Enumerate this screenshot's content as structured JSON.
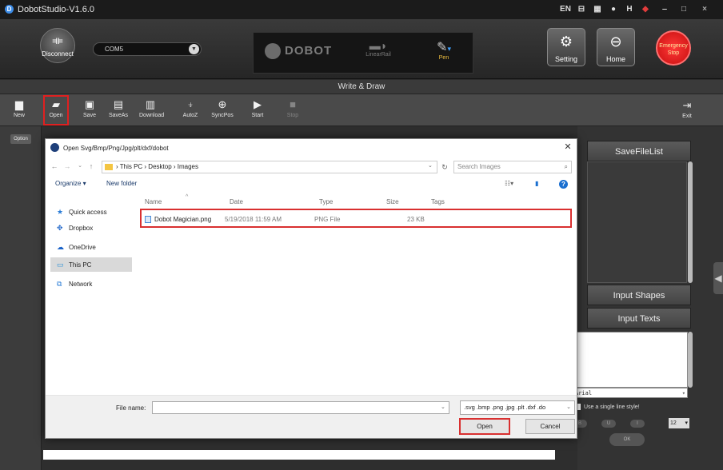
{
  "window": {
    "title": "DobotStudio-V1.6.0",
    "logo_glyph": "D",
    "title_icons": [
      "EN",
      "⊟",
      "▦",
      "●",
      "H",
      "◆",
      "‒",
      "□",
      "×"
    ]
  },
  "header": {
    "disconnect_label": "Disconnect",
    "port_value": "COM5",
    "brand": "DOBOT",
    "linear_rail_label": "LinearRail",
    "tool_label": "Pen",
    "setting_label": "Setting",
    "home_label": "Home",
    "estop_label": "Emergency Stop"
  },
  "mode_title": "Write & Draw",
  "toolbar": {
    "items": [
      {
        "label": "New",
        "icon": "new-file-icon"
      },
      {
        "label": "Open",
        "icon": "open-folder-icon"
      },
      {
        "label": "Save",
        "icon": "save-icon"
      },
      {
        "label": "SaveAs",
        "icon": "save-as-icon"
      },
      {
        "label": "Download",
        "icon": "download-icon"
      },
      {
        "label": "AutoZ",
        "icon": "autoz-icon"
      },
      {
        "label": "SyncPos",
        "icon": "syncpos-icon"
      },
      {
        "label": "Start",
        "icon": "play-icon"
      },
      {
        "label": "Stop",
        "icon": "stop-icon"
      }
    ],
    "exit_label": "Exit"
  },
  "left_panel": {
    "option_label": "Option"
  },
  "right_panel": {
    "save_file_list": "SaveFileList",
    "input_shapes": "Input Shapes",
    "input_texts": "Input Texts",
    "font_value": "Arial",
    "single_line_label": "Use a single line style!",
    "format_buttons": [
      "B",
      "U",
      "I"
    ],
    "size_value": "12",
    "ok_label": "OK"
  },
  "dialog": {
    "title": "Open Svg/Bmp/Png/Jpg/plt/dxf/dobot",
    "address": "› This PC › Desktop › Images",
    "search_placeholder": "Search Images",
    "organize_label": "Organize ▾",
    "new_folder_label": "New folder",
    "nav_items": [
      {
        "label": "Quick access",
        "icon": "star-icon"
      },
      {
        "label": "Dropbox",
        "icon": "dropbox-icon"
      },
      {
        "label": "OneDrive",
        "icon": "cloud-icon"
      },
      {
        "label": "This PC",
        "icon": "computer-icon"
      },
      {
        "label": "Network",
        "icon": "network-icon"
      }
    ],
    "columns": [
      "Name",
      "Date",
      "Type",
      "Size",
      "Tags"
    ],
    "files": [
      {
        "name": "Dobot Magician.png",
        "date": "5/19/2018 11:59 AM",
        "type": "PNG File",
        "size": "23 KB"
      }
    ],
    "file_name_label": "File name:",
    "file_name_value": "",
    "file_type_filter": ".svg .bmp .png .jpg .plt .dxf .do",
    "open_label": "Open",
    "cancel_label": "Cancel"
  }
}
